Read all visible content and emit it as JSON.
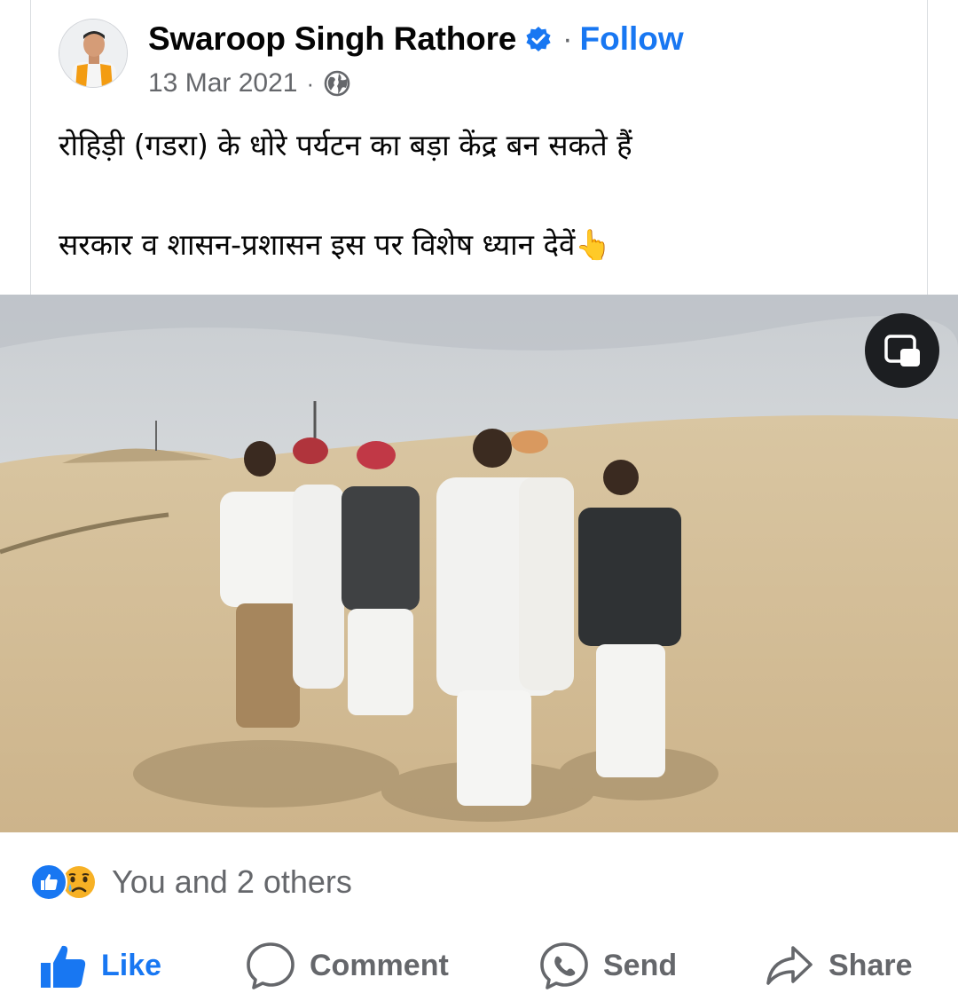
{
  "post": {
    "author_name": "Swaroop Singh Rathore",
    "separator": "·",
    "follow_label": "Follow",
    "date": "13 Mar 2021",
    "meta_separator": "·",
    "text_line_1": "रोहिड़ी (गडरा) के धोरे पर्यटन का बड़ा केंद्र बन सकते हैं",
    "text_line_2": "सरकार व शासन-प्रशासन इस पर विशेष ध्यान देवें👆",
    "audience_icon": "globe-icon",
    "verified_icon": "verified-badge-icon"
  },
  "media": {
    "type": "photo",
    "toggle_icon": "picture-in-picture-icon"
  },
  "reactions": {
    "icons": [
      "like-reaction-icon",
      "sad-reaction-icon"
    ],
    "summary": "You and 2 others"
  },
  "actions": {
    "like": "Like",
    "comment": "Comment",
    "send": "Send",
    "share": "Share"
  },
  "colors": {
    "brand_blue": "#1877f2",
    "secondary_text": "#65676b",
    "primary_text": "#050505"
  }
}
